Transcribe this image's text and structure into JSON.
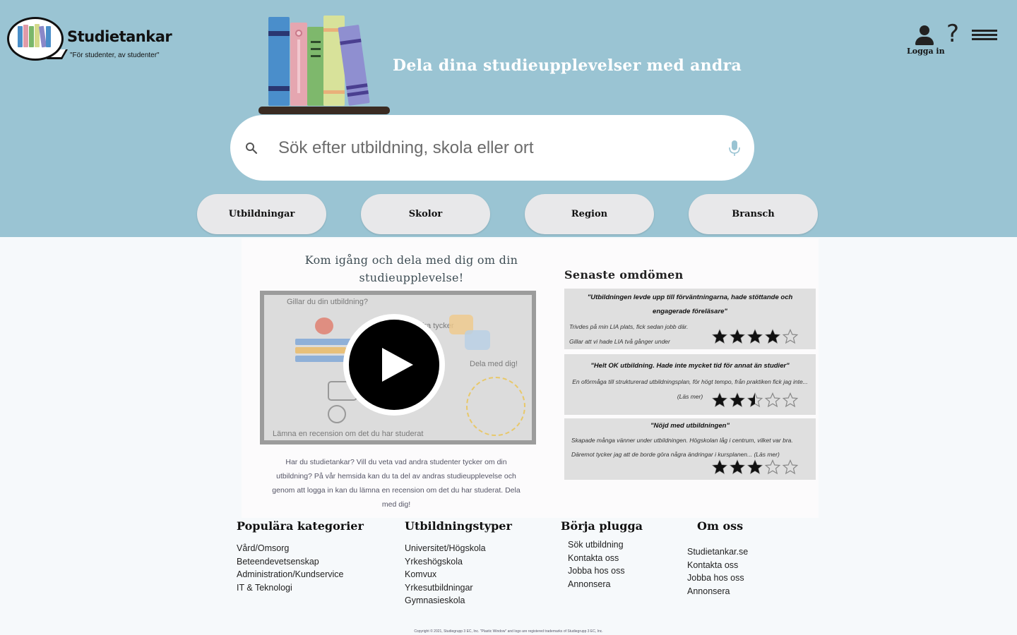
{
  "brand": {
    "name": "Studietankar",
    "slogan": "\"För studenter, av studenter\""
  },
  "header": {
    "tagline": "Dela dina studieupplevelser med andra",
    "login_label": "Logga in",
    "help_symbol": "?"
  },
  "search": {
    "placeholder": "Sök efter utbildning, skola eller ort"
  },
  "categories": [
    "Utbildningar",
    "Skolor",
    "Region",
    "Bransch"
  ],
  "intro": {
    "title": "Kom igång och dela med dig om din studieupplevelse!",
    "video": {
      "text_top": "Gillar du din utbildning?",
      "text_middle": "andra tycker",
      "text_right": "Dela med dig!",
      "text_bottom": "Lämna en recension om det du har studerat"
    },
    "text": "Har du studietankar? Vill du veta vad andra studenter tycker om din utbildning? På vår hemsida kan du ta del av andras studieupplevelse och genom att logga in kan du lämna en recension om det du har studerat. Dela med dig!"
  },
  "reviews": {
    "title": "Senaste omdömen",
    "items": [
      {
        "quote": "\"Utbildningen levde upp till förväntningarna, hade stöttande och engagerade föreläsare\"",
        "body": "Trivdes på min LIA plats, fick sedan jobb där. Gillar att vi hade LIA två gånger under utbildningen...  (Läs mer)",
        "rating": 4
      },
      {
        "quote": "\"Helt OK utbildning. Hade inte mycket tid för annat än studier\"",
        "body": "En oförmåga till strukturerad utbildningsplan, för högt tempo, från praktiken fick jag inte... (Läs mer)",
        "rating": 2.5
      },
      {
        "quote": "\"Nöjd med utbildningen\"",
        "body": "Skapade många vänner under utbildningen. Högskolan låg i centrum, vilket var bra. Däremot tycker jag att de borde göra några ändringar i kursplanen...  (Läs mer)",
        "rating": 3
      }
    ]
  },
  "footer": {
    "columns": [
      {
        "heading": "Populära kategorier",
        "links": [
          "Vård/Omsorg",
          "Beteendevetsenskap",
          "Administration/Kundservice",
          "IT & Teknologi"
        ]
      },
      {
        "heading": "Utbildningstyper",
        "links": [
          "Universitet/Högskola",
          "Yrkeshögskola",
          "Komvux",
          "Yrkesutbildningar",
          "Gymnasieskola"
        ]
      },
      {
        "heading": "Börja plugga",
        "links": [
          "Sök utbildning",
          "Kontakta oss",
          "Jobba hos oss",
          "Annonsera"
        ]
      },
      {
        "heading": "Om oss",
        "links": [
          "Studietankar.se",
          "Kontakta oss",
          "Jobba hos oss",
          "Annonsera"
        ]
      }
    ],
    "copyright": "Copyright © 2021, Studiegrupp 3 EC, Inc. \"Plastic Window\" and logo are registered trademarks of Studiegrupp 3 EC, Inc."
  },
  "colors": {
    "header_bg": "#9ac4d3",
    "button_bg": "#e8e8ea",
    "review_bg": "#dfdfdf",
    "star_filled": "#111111"
  }
}
